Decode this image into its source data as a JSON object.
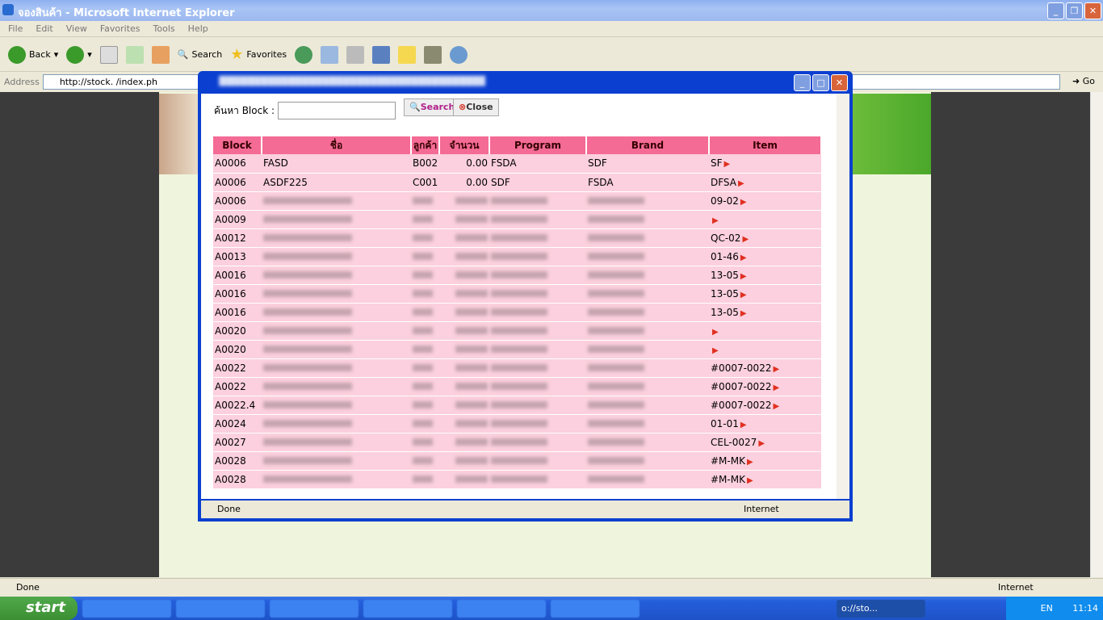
{
  "browser": {
    "title": "จองสินค้า - Microsoft Internet Explorer",
    "menu": [
      "File",
      "Edit",
      "View",
      "Favorites",
      "Tools",
      "Help"
    ],
    "back": "Back",
    "search": "Search",
    "favorites": "Favorites",
    "address_label": "Address",
    "address": "http://stock.            /index.ph",
    "go": "Go",
    "status": "Done",
    "zone": "Internet"
  },
  "popup": {
    "search_label": "ค้นหา Block :",
    "search_value": "",
    "search_button": "Search",
    "close_button": "Close",
    "status": "Done",
    "zone": "Internet",
    "columns": [
      "Block",
      "ชื่อ",
      "ลูกค้า",
      "จำนวน",
      "Program",
      "Brand",
      "Item"
    ],
    "rows": [
      {
        "block": "A0006",
        "name": "FASD",
        "cust": "B002",
        "qty": "0.00",
        "program": "FSDA",
        "brand": "SDF",
        "item": "SF"
      },
      {
        "block": "A0006",
        "name": "ASDF225",
        "cust": "C001",
        "qty": "0.00",
        "program": "SDF",
        "brand": "FSDA",
        "item": "DFSA"
      },
      {
        "block": "A0006",
        "item": "09-02"
      },
      {
        "block": "A0009",
        "item": ""
      },
      {
        "block": "A0012",
        "item": "QC-02"
      },
      {
        "block": "A0013",
        "item": "01-46"
      },
      {
        "block": "A0016",
        "item": "13-05"
      },
      {
        "block": "A0016",
        "item": "13-05"
      },
      {
        "block": "A0016",
        "item": "13-05"
      },
      {
        "block": "A0020",
        "item": ""
      },
      {
        "block": "A0020",
        "item": ""
      },
      {
        "block": "A0022",
        "item": "#0007-0022"
      },
      {
        "block": "A0022",
        "item": "#0007-0022"
      },
      {
        "block": "A0022.4",
        "item": "#0007-0022"
      },
      {
        "block": "A0024",
        "item": "01-01"
      },
      {
        "block": "A0027",
        "item": "CEL-0027"
      },
      {
        "block": "A0028",
        "item": "#M-MK"
      },
      {
        "block": "A0028",
        "item": "#M-MK"
      }
    ]
  },
  "taskbar": {
    "start": "start",
    "active_task": "o://sto...",
    "lang": "EN",
    "clock": "11:14"
  }
}
